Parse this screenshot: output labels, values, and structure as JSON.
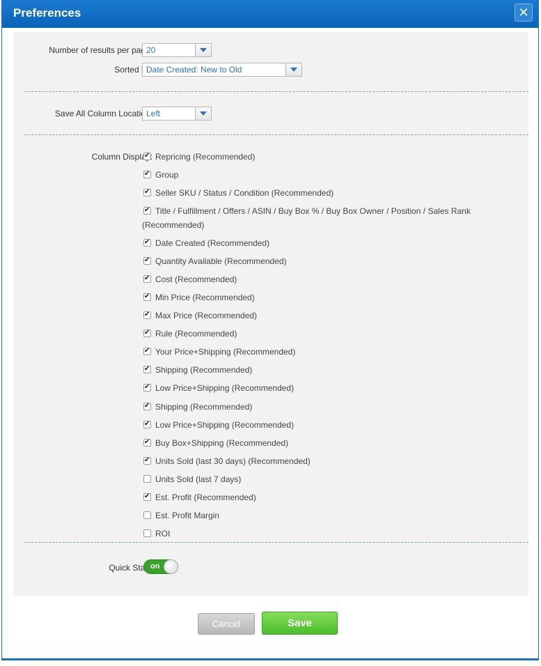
{
  "dialog": {
    "title": "Preferences",
    "close_icon": "✕"
  },
  "results": {
    "label": "Number of results per page:",
    "value": "20"
  },
  "sort": {
    "label": "Sorted by:",
    "value": "Date Created: New to Old"
  },
  "column_location": {
    "label": "Save All Column Location:",
    "value": "Left"
  },
  "column_display": {
    "label": "Column Display:",
    "items": [
      {
        "label": "Repricing (Recommended)",
        "checked": true
      },
      {
        "label": "Group",
        "checked": true
      },
      {
        "label": "Seller SKU / Status / Condition (Recommended)",
        "checked": true
      },
      {
        "label": "Title / Fulfillment / Offers / ASIN / Buy Box % / Buy Box Owner / Position / Sales Rank",
        "label2": "(Recommended)",
        "checked": true
      },
      {
        "label": "Date Created (Recommended)",
        "checked": true
      },
      {
        "label": "Quantity Available (Recommended)",
        "checked": true
      },
      {
        "label": "Cost (Recommended)",
        "checked": true
      },
      {
        "label": "Min Price (Recommended)",
        "checked": true
      },
      {
        "label": "Max Price (Recommended)",
        "checked": true
      },
      {
        "label": "Rule (Recommended)",
        "checked": true
      },
      {
        "label": "Your Price+Shipping (Recommended)",
        "checked": true
      },
      {
        "label": "Shipping (Recommended)",
        "checked": true
      },
      {
        "label": "Low Price+Shipping (Recommended)",
        "checked": true
      },
      {
        "label": "Shipping (Recommended)",
        "checked": true
      },
      {
        "label": "Low Price+Shipping (Recommended)",
        "checked": true
      },
      {
        "label": "Buy Box+Shipping (Recommended)",
        "checked": true
      },
      {
        "label": "Units Sold (last 30 days) (Recommended)",
        "checked": true
      },
      {
        "label": "Units Sold (last 7 days)",
        "checked": false
      },
      {
        "label": "Est. Profit (Recommended)",
        "checked": true
      },
      {
        "label": "Est. Profit Margin",
        "checked": false
      },
      {
        "label": "ROI",
        "checked": false
      }
    ]
  },
  "quick_start": {
    "label": "Quick Start:",
    "state": "on"
  },
  "buttons": {
    "cancel": "Cancel",
    "save": "Save"
  },
  "colors": {
    "title_bar": "#0a64b8",
    "save_button": "#4cbd2b",
    "toggle_on": "#3aa02c",
    "select_text": "#2a73c6"
  }
}
